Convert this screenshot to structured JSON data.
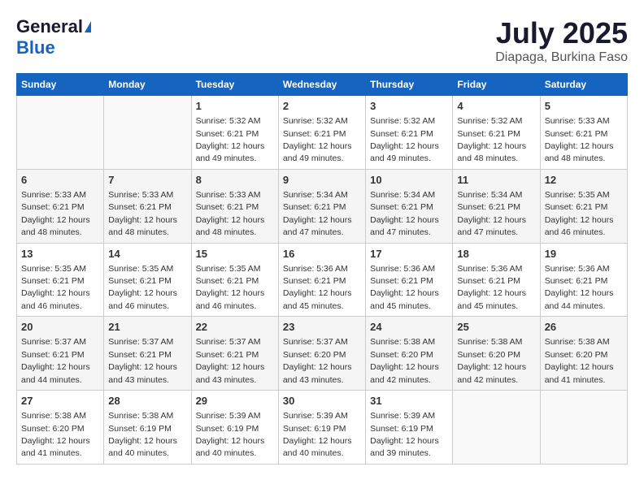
{
  "header": {
    "logo_general": "General",
    "logo_blue": "Blue",
    "title": "July 2025",
    "location": "Diapaga, Burkina Faso"
  },
  "weekdays": [
    "Sunday",
    "Monday",
    "Tuesday",
    "Wednesday",
    "Thursday",
    "Friday",
    "Saturday"
  ],
  "weeks": [
    [
      {
        "day": "",
        "info": ""
      },
      {
        "day": "",
        "info": ""
      },
      {
        "day": "1",
        "sunrise": "Sunrise: 5:32 AM",
        "sunset": "Sunset: 6:21 PM",
        "daylight": "Daylight: 12 hours and 49 minutes."
      },
      {
        "day": "2",
        "sunrise": "Sunrise: 5:32 AM",
        "sunset": "Sunset: 6:21 PM",
        "daylight": "Daylight: 12 hours and 49 minutes."
      },
      {
        "day": "3",
        "sunrise": "Sunrise: 5:32 AM",
        "sunset": "Sunset: 6:21 PM",
        "daylight": "Daylight: 12 hours and 49 minutes."
      },
      {
        "day": "4",
        "sunrise": "Sunrise: 5:32 AM",
        "sunset": "Sunset: 6:21 PM",
        "daylight": "Daylight: 12 hours and 48 minutes."
      },
      {
        "day": "5",
        "sunrise": "Sunrise: 5:33 AM",
        "sunset": "Sunset: 6:21 PM",
        "daylight": "Daylight: 12 hours and 48 minutes."
      }
    ],
    [
      {
        "day": "6",
        "sunrise": "Sunrise: 5:33 AM",
        "sunset": "Sunset: 6:21 PM",
        "daylight": "Daylight: 12 hours and 48 minutes."
      },
      {
        "day": "7",
        "sunrise": "Sunrise: 5:33 AM",
        "sunset": "Sunset: 6:21 PM",
        "daylight": "Daylight: 12 hours and 48 minutes."
      },
      {
        "day": "8",
        "sunrise": "Sunrise: 5:33 AM",
        "sunset": "Sunset: 6:21 PM",
        "daylight": "Daylight: 12 hours and 48 minutes."
      },
      {
        "day": "9",
        "sunrise": "Sunrise: 5:34 AM",
        "sunset": "Sunset: 6:21 PM",
        "daylight": "Daylight: 12 hours and 47 minutes."
      },
      {
        "day": "10",
        "sunrise": "Sunrise: 5:34 AM",
        "sunset": "Sunset: 6:21 PM",
        "daylight": "Daylight: 12 hours and 47 minutes."
      },
      {
        "day": "11",
        "sunrise": "Sunrise: 5:34 AM",
        "sunset": "Sunset: 6:21 PM",
        "daylight": "Daylight: 12 hours and 47 minutes."
      },
      {
        "day": "12",
        "sunrise": "Sunrise: 5:35 AM",
        "sunset": "Sunset: 6:21 PM",
        "daylight": "Daylight: 12 hours and 46 minutes."
      }
    ],
    [
      {
        "day": "13",
        "sunrise": "Sunrise: 5:35 AM",
        "sunset": "Sunset: 6:21 PM",
        "daylight": "Daylight: 12 hours and 46 minutes."
      },
      {
        "day": "14",
        "sunrise": "Sunrise: 5:35 AM",
        "sunset": "Sunset: 6:21 PM",
        "daylight": "Daylight: 12 hours and 46 minutes."
      },
      {
        "day": "15",
        "sunrise": "Sunrise: 5:35 AM",
        "sunset": "Sunset: 6:21 PM",
        "daylight": "Daylight: 12 hours and 46 minutes."
      },
      {
        "day": "16",
        "sunrise": "Sunrise: 5:36 AM",
        "sunset": "Sunset: 6:21 PM",
        "daylight": "Daylight: 12 hours and 45 minutes."
      },
      {
        "day": "17",
        "sunrise": "Sunrise: 5:36 AM",
        "sunset": "Sunset: 6:21 PM",
        "daylight": "Daylight: 12 hours and 45 minutes."
      },
      {
        "day": "18",
        "sunrise": "Sunrise: 5:36 AM",
        "sunset": "Sunset: 6:21 PM",
        "daylight": "Daylight: 12 hours and 45 minutes."
      },
      {
        "day": "19",
        "sunrise": "Sunrise: 5:36 AM",
        "sunset": "Sunset: 6:21 PM",
        "daylight": "Daylight: 12 hours and 44 minutes."
      }
    ],
    [
      {
        "day": "20",
        "sunrise": "Sunrise: 5:37 AM",
        "sunset": "Sunset: 6:21 PM",
        "daylight": "Daylight: 12 hours and 44 minutes."
      },
      {
        "day": "21",
        "sunrise": "Sunrise: 5:37 AM",
        "sunset": "Sunset: 6:21 PM",
        "daylight": "Daylight: 12 hours and 43 minutes."
      },
      {
        "day": "22",
        "sunrise": "Sunrise: 5:37 AM",
        "sunset": "Sunset: 6:21 PM",
        "daylight": "Daylight: 12 hours and 43 minutes."
      },
      {
        "day": "23",
        "sunrise": "Sunrise: 5:37 AM",
        "sunset": "Sunset: 6:20 PM",
        "daylight": "Daylight: 12 hours and 43 minutes."
      },
      {
        "day": "24",
        "sunrise": "Sunrise: 5:38 AM",
        "sunset": "Sunset: 6:20 PM",
        "daylight": "Daylight: 12 hours and 42 minutes."
      },
      {
        "day": "25",
        "sunrise": "Sunrise: 5:38 AM",
        "sunset": "Sunset: 6:20 PM",
        "daylight": "Daylight: 12 hours and 42 minutes."
      },
      {
        "day": "26",
        "sunrise": "Sunrise: 5:38 AM",
        "sunset": "Sunset: 6:20 PM",
        "daylight": "Daylight: 12 hours and 41 minutes."
      }
    ],
    [
      {
        "day": "27",
        "sunrise": "Sunrise: 5:38 AM",
        "sunset": "Sunset: 6:20 PM",
        "daylight": "Daylight: 12 hours and 41 minutes."
      },
      {
        "day": "28",
        "sunrise": "Sunrise: 5:38 AM",
        "sunset": "Sunset: 6:19 PM",
        "daylight": "Daylight: 12 hours and 40 minutes."
      },
      {
        "day": "29",
        "sunrise": "Sunrise: 5:39 AM",
        "sunset": "Sunset: 6:19 PM",
        "daylight": "Daylight: 12 hours and 40 minutes."
      },
      {
        "day": "30",
        "sunrise": "Sunrise: 5:39 AM",
        "sunset": "Sunset: 6:19 PM",
        "daylight": "Daylight: 12 hours and 40 minutes."
      },
      {
        "day": "31",
        "sunrise": "Sunrise: 5:39 AM",
        "sunset": "Sunset: 6:19 PM",
        "daylight": "Daylight: 12 hours and 39 minutes."
      },
      {
        "day": "",
        "info": ""
      },
      {
        "day": "",
        "info": ""
      }
    ]
  ]
}
